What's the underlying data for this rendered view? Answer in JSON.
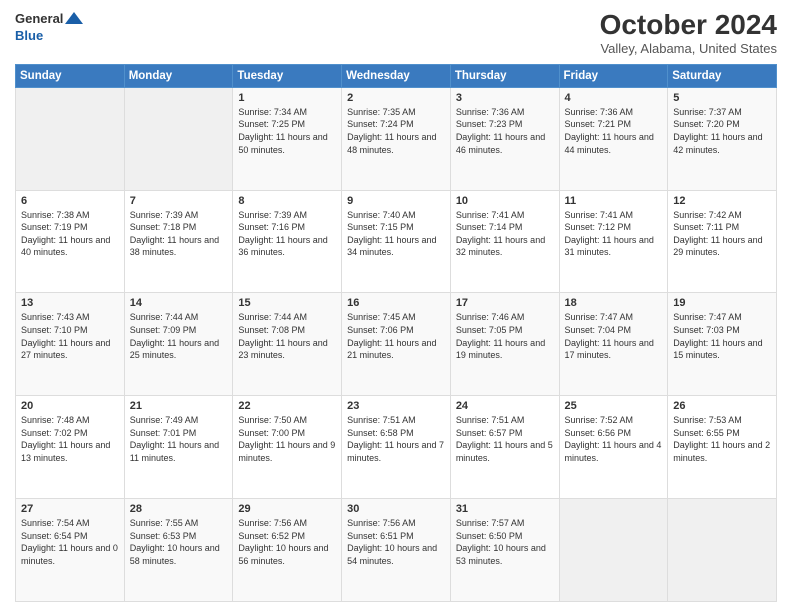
{
  "header": {
    "logo_general": "General",
    "logo_blue": "Blue",
    "title": "October 2024",
    "subtitle": "Valley, Alabama, United States"
  },
  "days_of_week": [
    "Sunday",
    "Monday",
    "Tuesday",
    "Wednesday",
    "Thursday",
    "Friday",
    "Saturday"
  ],
  "weeks": [
    [
      {
        "day": "",
        "info": ""
      },
      {
        "day": "",
        "info": ""
      },
      {
        "day": "1",
        "info": "Sunrise: 7:34 AM\nSunset: 7:25 PM\nDaylight: 11 hours and 50 minutes."
      },
      {
        "day": "2",
        "info": "Sunrise: 7:35 AM\nSunset: 7:24 PM\nDaylight: 11 hours and 48 minutes."
      },
      {
        "day": "3",
        "info": "Sunrise: 7:36 AM\nSunset: 7:23 PM\nDaylight: 11 hours and 46 minutes."
      },
      {
        "day": "4",
        "info": "Sunrise: 7:36 AM\nSunset: 7:21 PM\nDaylight: 11 hours and 44 minutes."
      },
      {
        "day": "5",
        "info": "Sunrise: 7:37 AM\nSunset: 7:20 PM\nDaylight: 11 hours and 42 minutes."
      }
    ],
    [
      {
        "day": "6",
        "info": "Sunrise: 7:38 AM\nSunset: 7:19 PM\nDaylight: 11 hours and 40 minutes."
      },
      {
        "day": "7",
        "info": "Sunrise: 7:39 AM\nSunset: 7:18 PM\nDaylight: 11 hours and 38 minutes."
      },
      {
        "day": "8",
        "info": "Sunrise: 7:39 AM\nSunset: 7:16 PM\nDaylight: 11 hours and 36 minutes."
      },
      {
        "day": "9",
        "info": "Sunrise: 7:40 AM\nSunset: 7:15 PM\nDaylight: 11 hours and 34 minutes."
      },
      {
        "day": "10",
        "info": "Sunrise: 7:41 AM\nSunset: 7:14 PM\nDaylight: 11 hours and 32 minutes."
      },
      {
        "day": "11",
        "info": "Sunrise: 7:41 AM\nSunset: 7:12 PM\nDaylight: 11 hours and 31 minutes."
      },
      {
        "day": "12",
        "info": "Sunrise: 7:42 AM\nSunset: 7:11 PM\nDaylight: 11 hours and 29 minutes."
      }
    ],
    [
      {
        "day": "13",
        "info": "Sunrise: 7:43 AM\nSunset: 7:10 PM\nDaylight: 11 hours and 27 minutes."
      },
      {
        "day": "14",
        "info": "Sunrise: 7:44 AM\nSunset: 7:09 PM\nDaylight: 11 hours and 25 minutes."
      },
      {
        "day": "15",
        "info": "Sunrise: 7:44 AM\nSunset: 7:08 PM\nDaylight: 11 hours and 23 minutes."
      },
      {
        "day": "16",
        "info": "Sunrise: 7:45 AM\nSunset: 7:06 PM\nDaylight: 11 hours and 21 minutes."
      },
      {
        "day": "17",
        "info": "Sunrise: 7:46 AM\nSunset: 7:05 PM\nDaylight: 11 hours and 19 minutes."
      },
      {
        "day": "18",
        "info": "Sunrise: 7:47 AM\nSunset: 7:04 PM\nDaylight: 11 hours and 17 minutes."
      },
      {
        "day": "19",
        "info": "Sunrise: 7:47 AM\nSunset: 7:03 PM\nDaylight: 11 hours and 15 minutes."
      }
    ],
    [
      {
        "day": "20",
        "info": "Sunrise: 7:48 AM\nSunset: 7:02 PM\nDaylight: 11 hours and 13 minutes."
      },
      {
        "day": "21",
        "info": "Sunrise: 7:49 AM\nSunset: 7:01 PM\nDaylight: 11 hours and 11 minutes."
      },
      {
        "day": "22",
        "info": "Sunrise: 7:50 AM\nSunset: 7:00 PM\nDaylight: 11 hours and 9 minutes."
      },
      {
        "day": "23",
        "info": "Sunrise: 7:51 AM\nSunset: 6:58 PM\nDaylight: 11 hours and 7 minutes."
      },
      {
        "day": "24",
        "info": "Sunrise: 7:51 AM\nSunset: 6:57 PM\nDaylight: 11 hours and 5 minutes."
      },
      {
        "day": "25",
        "info": "Sunrise: 7:52 AM\nSunset: 6:56 PM\nDaylight: 11 hours and 4 minutes."
      },
      {
        "day": "26",
        "info": "Sunrise: 7:53 AM\nSunset: 6:55 PM\nDaylight: 11 hours and 2 minutes."
      }
    ],
    [
      {
        "day": "27",
        "info": "Sunrise: 7:54 AM\nSunset: 6:54 PM\nDaylight: 11 hours and 0 minutes."
      },
      {
        "day": "28",
        "info": "Sunrise: 7:55 AM\nSunset: 6:53 PM\nDaylight: 10 hours and 58 minutes."
      },
      {
        "day": "29",
        "info": "Sunrise: 7:56 AM\nSunset: 6:52 PM\nDaylight: 10 hours and 56 minutes."
      },
      {
        "day": "30",
        "info": "Sunrise: 7:56 AM\nSunset: 6:51 PM\nDaylight: 10 hours and 54 minutes."
      },
      {
        "day": "31",
        "info": "Sunrise: 7:57 AM\nSunset: 6:50 PM\nDaylight: 10 hours and 53 minutes."
      },
      {
        "day": "",
        "info": ""
      },
      {
        "day": "",
        "info": ""
      }
    ]
  ]
}
